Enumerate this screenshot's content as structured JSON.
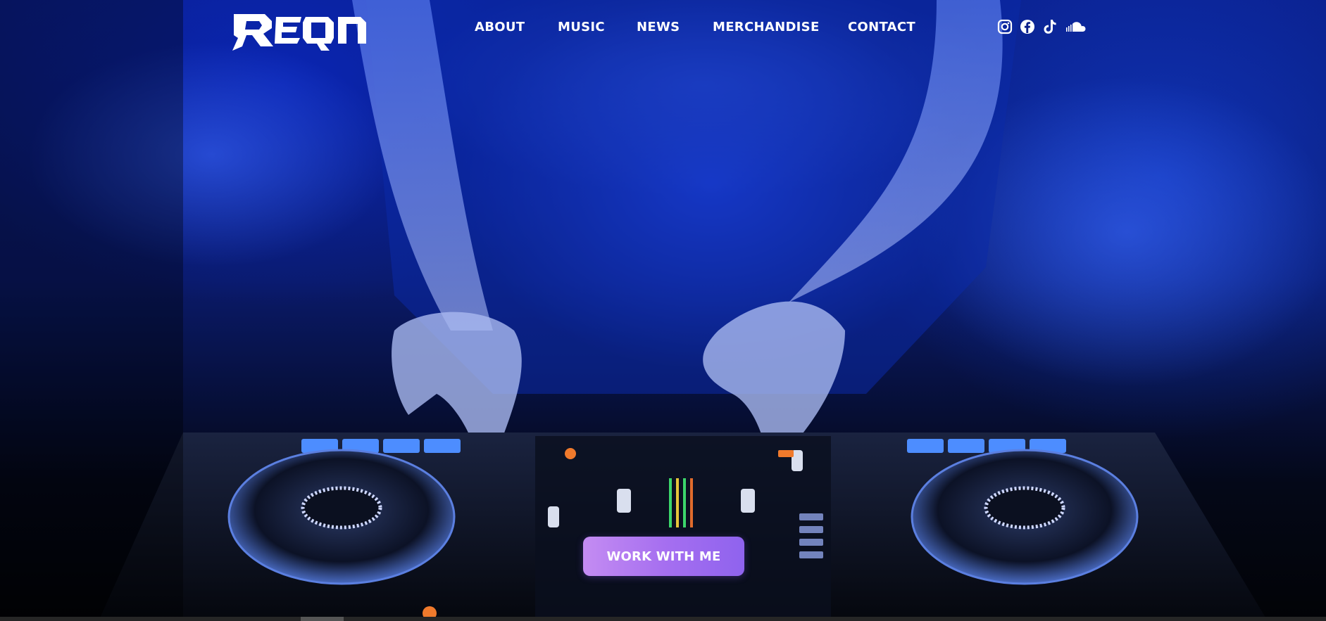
{
  "brand": {
    "logo_text": "REQON"
  },
  "nav": {
    "items": [
      {
        "label": "ABOUT"
      },
      {
        "label": "MUSIC"
      },
      {
        "label": "NEWS"
      },
      {
        "label": "MERCHANDISE"
      },
      {
        "label": "CONTACT"
      }
    ]
  },
  "social": {
    "icons": [
      "instagram-icon",
      "facebook-icon",
      "tiktok-icon",
      "soundcloud-icon"
    ]
  },
  "hero": {
    "cta_label": "WORK WITH ME",
    "accent_color": "#a66ff0",
    "background_color": "#0a1f8a"
  }
}
